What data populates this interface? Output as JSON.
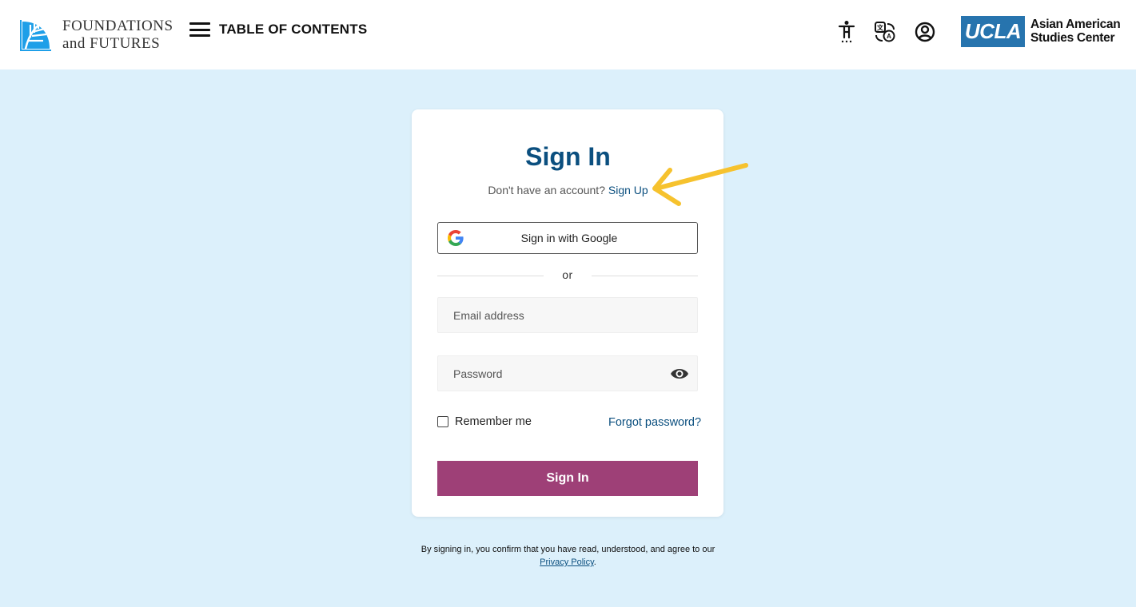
{
  "header": {
    "logo_line1": "FOUNDATIONS",
    "logo_line2": "and FUTURES",
    "menu_label": "TABLE OF CONTENTS",
    "icons": [
      "accessibility-icon",
      "translate-icon",
      "account-icon"
    ],
    "ucla_label": "UCLA",
    "center_line1": "Asian American",
    "center_line2": "Studies Center"
  },
  "signin": {
    "title": "Sign In",
    "no_account_text": "Don't have an account?",
    "signup_link": "Sign Up",
    "google_button": "Sign in with Google",
    "divider_text": "or",
    "email_placeholder": "Email address",
    "password_placeholder": "Password",
    "remember_label": "Remember me",
    "forgot_link": "Forgot password?",
    "submit_label": "Sign In"
  },
  "legal": {
    "text": "By signing in, you confirm that you have read, understood, and agree to our",
    "policy_link": "Privacy Policy",
    "suffix": "."
  },
  "colors": {
    "page_bg": "#dcf0fb",
    "primary_blue": "#0b4f7f",
    "ucla_blue": "#2774ae",
    "signin_button": "#9e4077",
    "annotation_arrow": "#f6c22e"
  }
}
